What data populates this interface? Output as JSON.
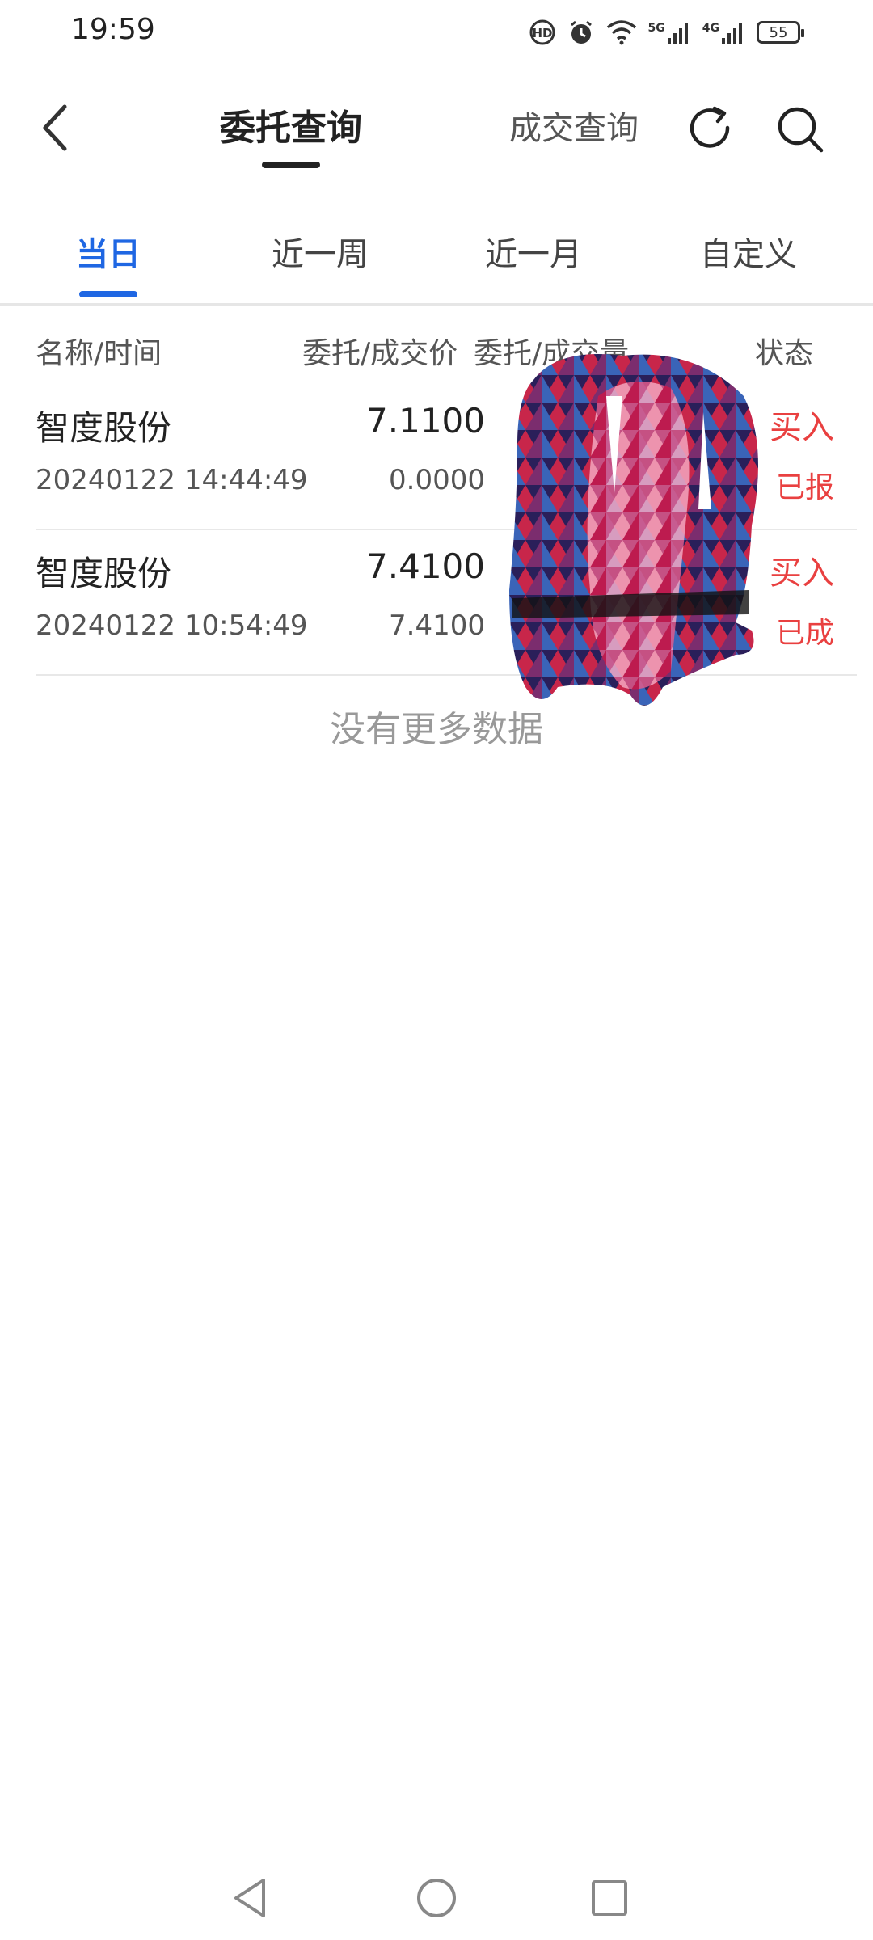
{
  "status_bar": {
    "time": "19:59",
    "net1_label": "5G",
    "net2_label": "4G",
    "battery": "55",
    "icons": [
      "hd-call-icon",
      "alarm-icon",
      "wifi-icon",
      "signal-5g-icon",
      "signal-4g-icon",
      "battery-icon"
    ]
  },
  "header": {
    "active_tab": "委托查询",
    "other_tab": "成交查询",
    "icons": [
      "back-arrow-icon",
      "refresh-icon",
      "search-icon"
    ]
  },
  "period_tabs": [
    {
      "label": "当日",
      "active": true
    },
    {
      "label": "近一周",
      "active": false
    },
    {
      "label": "近一月",
      "active": false
    },
    {
      "label": "自定义",
      "active": false
    }
  ],
  "columns": {
    "name_time": "名称/时间",
    "price": "委托/成交价",
    "volume": "委托/成交量",
    "status": "状态"
  },
  "orders": [
    {
      "name": "智度股份",
      "time": "20240122 14:44:49",
      "order_price": "7.1100",
      "deal_price": "0.0000",
      "direction": "买入",
      "status": "已报"
    },
    {
      "name": "智度股份",
      "time": "20240122 10:54:49",
      "order_price": "7.4100",
      "deal_price": "7.4100",
      "direction": "买入",
      "status": "已成"
    }
  ],
  "footer_text": "没有更多数据",
  "colors": {
    "accent": "#1f67e3",
    "buy_red": "#e94040",
    "text_dark": "#222222",
    "text_muted": "#999999"
  },
  "nav_bar": {
    "icons": [
      "nav-back-icon",
      "nav-home-icon",
      "nav-recents-icon"
    ]
  }
}
